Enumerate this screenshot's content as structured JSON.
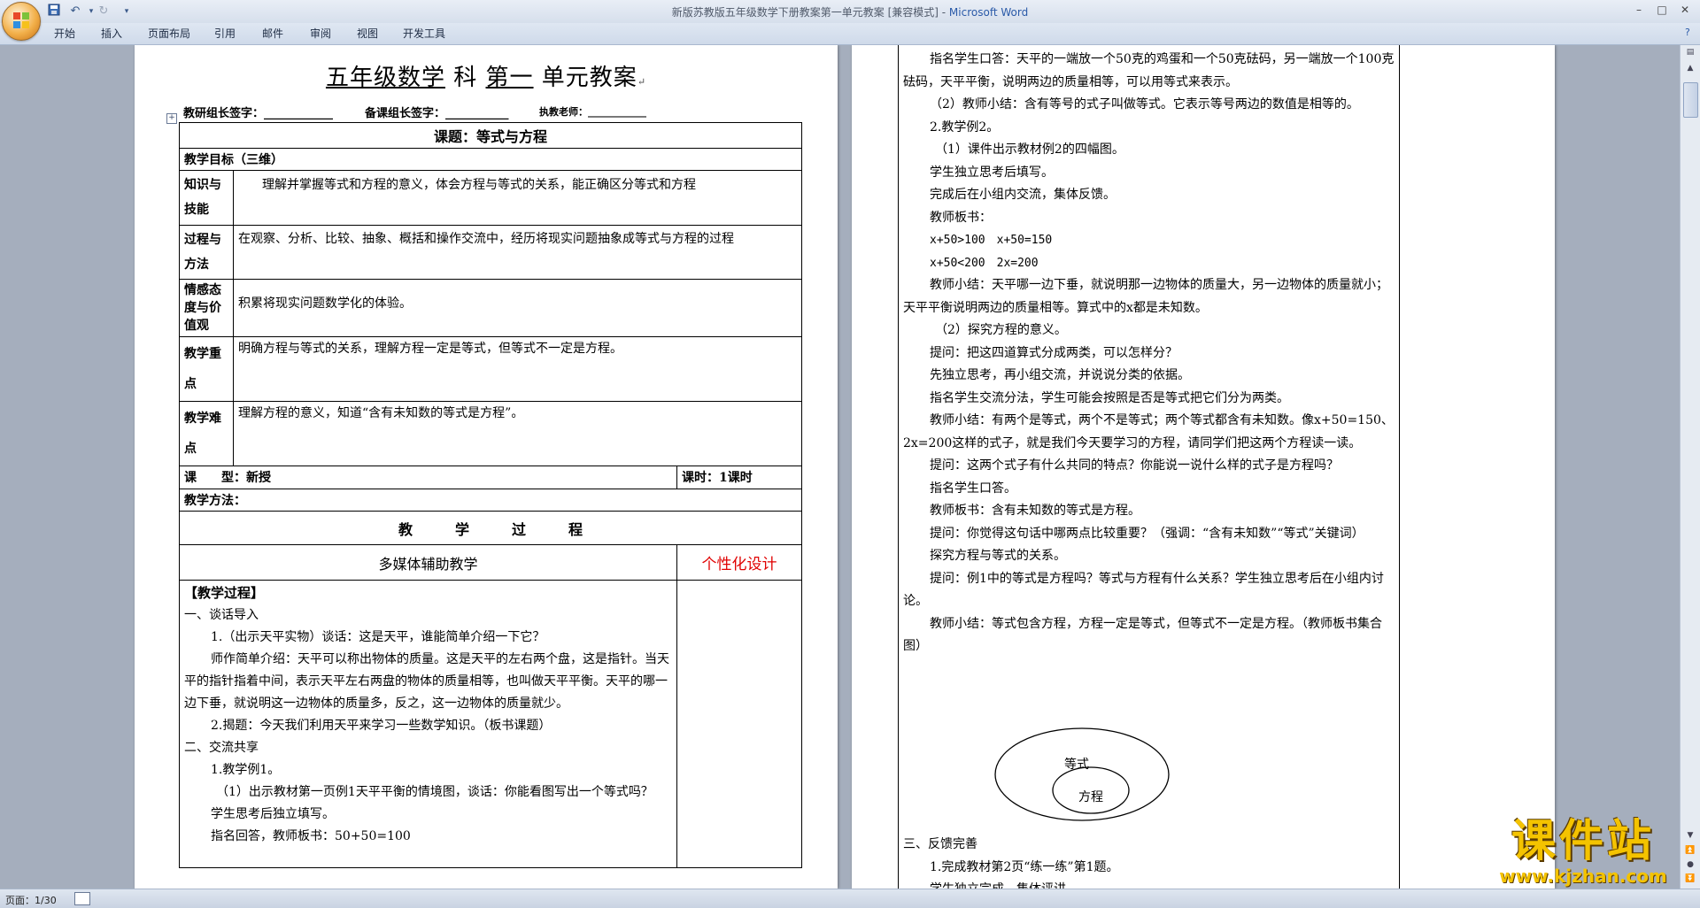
{
  "window": {
    "title": "新版苏教版五年级数学下册教案第一单元教案 [兼容模式] - ",
    "app_name": "Microsoft Word",
    "min": "–",
    "max": "□",
    "close": "✕"
  },
  "ribbon_tabs": [
    "开始",
    "插入",
    "页面布局",
    "引用",
    "邮件",
    "审阅",
    "视图",
    "开发工具"
  ],
  "page1": {
    "title_pre": "五年级数学",
    "title_subject": "科",
    "title_unit": "第一",
    "title_post": "单元教案",
    "para_mark": "↵",
    "sign_research": "教研组长签字：____________",
    "sign_prep": "备课组长签字：___________",
    "sign_teacher": "执教老师：____________",
    "topic": "课题：等式与方程",
    "goal_header": "教学目标（三维）",
    "rows": [
      {
        "label": "知识与技能",
        "text": "理解并掌握等式和方程的意义，体会方程与等式的关系，能正确区分等式和方程"
      },
      {
        "label": "过程与方法",
        "text": "在观察、分析、比较、抽象、概括和操作交流中，经历将现实问题抽象成等式与方程的过程"
      },
      {
        "label": "情感态度与价值观",
        "text": "积累将现实问题数学化的体验。"
      },
      {
        "label": "教学重点",
        "text": "明确方程与等式的关系，理解方程一定是等式，但等式不一定是方程。"
      },
      {
        "label": "教学难点",
        "text": "理解方程的意义，知道“含有未知数的等式是方程”。"
      }
    ],
    "course_type": "课　　型：新授",
    "course_hours": "课时：1课时",
    "method": "教学方法：",
    "process_header": "教　　　学　　　过　　　程",
    "multimedia": "多媒体辅助教学",
    "personal_design": "个性化设计",
    "process_lines": [
      "【教学过程】",
      "一、谈话导入",
      "1.（出示天平实物）谈话：这是天平，谁能简单介绍一下它？",
      "师作简单介绍：天平可以称出物体的质量。这是天平的左右两个盘，这是指针。当天平的指针指着中间，表示天平左右两盘的物体的质量相等，也叫做天平平衡。天平的哪一边下垂，就说明这一边物体的质量多，反之，这一边物体的质量就少。",
      "2.揭题：今天我们利用天平来学习一些数学知识。（板书课题）",
      "二、交流共享",
      "1.教学例1。",
      "（1）出示教材第一页例1天平平衡的情境图，谈话：你能看图写出一个等式吗？",
      "学生思考后独立填写。",
      "指名回答，教师板书：50+50=100"
    ]
  },
  "page2": {
    "lines": [
      "指名学生口答：天平的一端放一个50克的鸡蛋和一个50克砝码，另一端放一个100克砝码，天平平衡，说明两边的质量相等，可以用等式来表示。",
      "（2）教师小结：含有等号的式子叫做等式。它表示等号两边的数值是相等的。",
      "2.教学例2。",
      "（1）课件出示教材例2的四幅图。",
      "学生独立思考后填写。",
      "完成后在小组内交流，集体反馈。",
      "教师板书：",
      "x+50>100　x+50=150",
      "x+50<200　2x=200",
      "教师小结：天平哪一边下垂，就说明那一边物体的质量大，另一边物体的质量就小；天平平衡说明两边的质量相等。算式中的x都是未知数。",
      "（2）探究方程的意义。",
      "提问：把这四道算式分成两类，可以怎样分？",
      "先独立思考，再小组交流，并说说分类的依据。",
      "指名学生交流分法，学生可能会按照是否是等式把它们分为两类。",
      "教师小结：有两个是等式，两个不是等式；两个等式都含有未知数。像x+50=150、2x=200这样的式子，就是我们今天要学习的方程，请同学们把这两个方程读一读。",
      "提问：这两个式子有什么共同的特点？你能说一说什么样的式子是方程吗？",
      "指名学生口答。",
      "教师板书：含有未知数的等式是方程。",
      "提问：你觉得这句话中哪两点比较重要？（强调：“含有未知数”“等式”关键词）",
      "探究方程与等式的关系。",
      "提问：例1中的等式是方程吗？等式与方程有什么关系？学生独立思考后在小组内讨论。",
      "教师小结：等式包含方程，方程一定是等式，但等式不一定是方程。（教师板书集合图）"
    ],
    "venn_outer": "等式",
    "venn_inner": "方程",
    "after_lines": [
      "三、反馈完善",
      "1.完成教材第2页“练一练”第1题。",
      "学生独立完成，集体评讲。"
    ]
  },
  "status": {
    "page": "页面：1/30"
  },
  "watermark": {
    "big": "课件站",
    "url": "www.kjzhan.com"
  }
}
